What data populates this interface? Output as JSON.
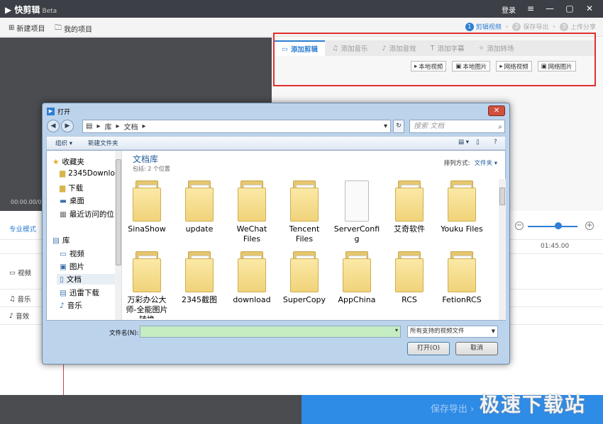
{
  "app": {
    "name": "快剪辑",
    "beta": "Beta",
    "login": "登录"
  },
  "menubar": {
    "new_project": "新建项目",
    "my_projects": "我的项目"
  },
  "steps": [
    {
      "num": "1",
      "label": "剪辑视频"
    },
    {
      "num": "2",
      "label": "保存导出"
    },
    {
      "num": "3",
      "label": "上传分享"
    }
  ],
  "preview": {
    "time": "00:00.00/00:"
  },
  "panel": {
    "tabs": [
      "添加剪辑",
      "添加音乐",
      "添加音效",
      "添加字幕",
      "添加转场"
    ],
    "sources": [
      "本地视频",
      "本地图片",
      "网络视频",
      "网络图片"
    ]
  },
  "timeline": {
    "mode": "专业模式",
    "tracks": [
      "视频",
      "音乐",
      "音效"
    ],
    "time_mark": "01:45.00"
  },
  "bottom": {
    "export": "保存导出 ›",
    "watermark": "极速下载站"
  },
  "dialog": {
    "title": "打开",
    "breadcrumb": [
      "库",
      "文档"
    ],
    "search_placeholder": "搜索 文档",
    "organize": "组织 ▾",
    "new_folder": "新建文件夹",
    "nav": {
      "favorites": "收藏夹",
      "fav_items": [
        "2345Downlo",
        "下载",
        "桌面",
        "最近访问的位"
      ],
      "libraries": "库",
      "lib_items": [
        "视频",
        "图片",
        "文档",
        "迅雷下载",
        "音乐"
      ]
    },
    "library_title": "文档库",
    "library_sub": "包括: 2 个位置",
    "sort_label": "排列方式:",
    "sort_value": "文件夹 ▾",
    "items_row1": [
      "SinaShow",
      "update",
      "WeChat Files",
      "Tencent Files",
      "ServerConfig",
      "艾奇软件",
      "Youku Files"
    ],
    "items_row2": [
      "万彩办公大师-全能图片转换",
      "2345截图",
      "download",
      "SuperCopy",
      "AppChina",
      "RCS",
      "FetionRCS"
    ],
    "filename_label": "文件名(N):",
    "filetype": "所有支持的视频文件",
    "open": "打开(O)",
    "cancel": "取消"
  }
}
